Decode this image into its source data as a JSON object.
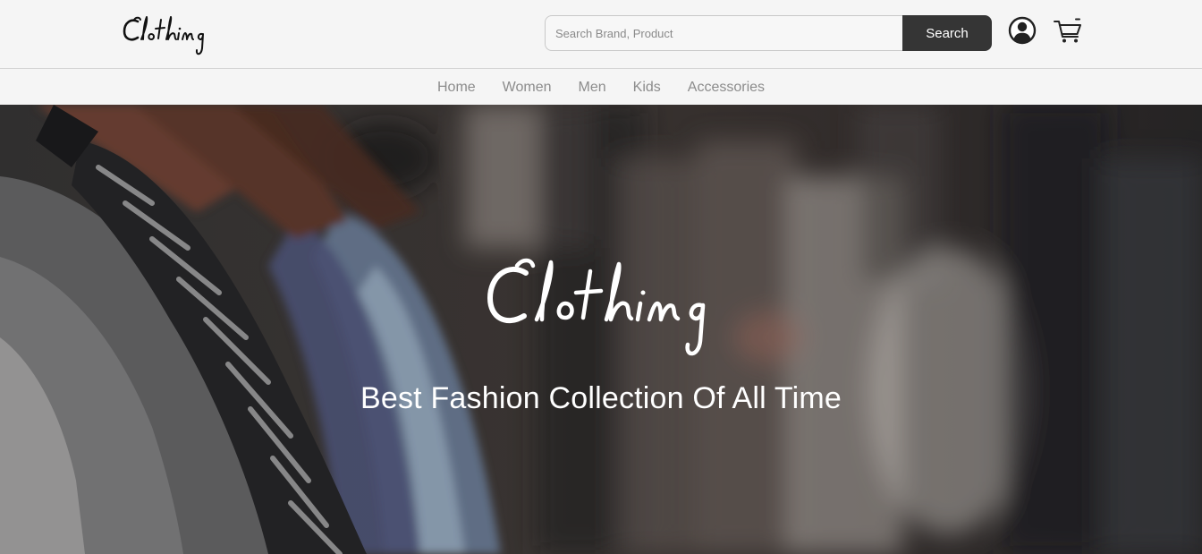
{
  "header": {
    "logo_text": "Clothing",
    "search": {
      "placeholder": "Search Brand, Product",
      "value": "",
      "button_label": "Search"
    },
    "icons": [
      "user-account-icon",
      "shopping-cart-icon"
    ]
  },
  "nav": {
    "items": [
      {
        "label": "Home"
      },
      {
        "label": "Women"
      },
      {
        "label": "Men"
      },
      {
        "label": "Kids"
      },
      {
        "label": "Accessories"
      }
    ]
  },
  "hero": {
    "logo_text": "Clothing",
    "tagline": "Best Fashion Collection Of All Time"
  },
  "colors": {
    "page_bg": "#f5f5f5",
    "button_dark": "#353535",
    "nav_text": "#8c8c8c",
    "hero_text": "#ffffff"
  }
}
